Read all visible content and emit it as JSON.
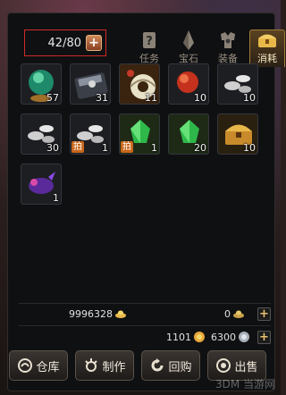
{
  "capacity": {
    "text": "42/80",
    "plus": "+"
  },
  "tabs": [
    {
      "label": "任务",
      "icon": "quest-scroll-icon"
    },
    {
      "label": "宝石",
      "icon": "gem-crystal-icon"
    },
    {
      "label": "装备",
      "icon": "armor-icon"
    },
    {
      "label": "消耗",
      "icon": "treasure-chest-icon",
      "active": true
    }
  ],
  "items": [
    {
      "icon": "green-orb-icon",
      "count": "57",
      "tag": ""
    },
    {
      "icon": "gift-box-icon",
      "count": "31",
      "tag": ""
    },
    {
      "icon": "jade-pendant-icon",
      "count": "11",
      "tag": ""
    },
    {
      "icon": "red-orb-icon",
      "count": "10",
      "tag": ""
    },
    {
      "icon": "silver-nuggets-icon",
      "count": "10",
      "tag": ""
    },
    {
      "icon": "silver-nuggets-icon",
      "count": "30",
      "tag": ""
    },
    {
      "icon": "silver-nuggets-icon",
      "count": "1",
      "tag": "拍"
    },
    {
      "icon": "green-crystal-icon",
      "count": "1",
      "tag": "拍"
    },
    {
      "icon": "green-crystal-icon",
      "count": "20",
      "tag": ""
    },
    {
      "icon": "golden-chest-icon",
      "count": "10",
      "tag": ""
    },
    {
      "icon": "purple-beast-icon",
      "count": "1",
      "tag": ""
    }
  ],
  "currency": {
    "gold_ingot": "9996328",
    "bound_ingot": "0",
    "gold_coin": "1101",
    "silver_coin": "6300",
    "plus": "+"
  },
  "buttons": [
    {
      "label": "仓库",
      "icon": "warehouse-icon"
    },
    {
      "label": "制作",
      "icon": "crafting-icon"
    },
    {
      "label": "回购",
      "icon": "buyback-icon"
    },
    {
      "label": "出售",
      "icon": "sell-icon"
    }
  ],
  "watermark": "3DM 当游网",
  "colors": {
    "accent_orange": "#c8671b",
    "capacity_border": "#d02a2a",
    "panel_bg": "#0f1012"
  }
}
